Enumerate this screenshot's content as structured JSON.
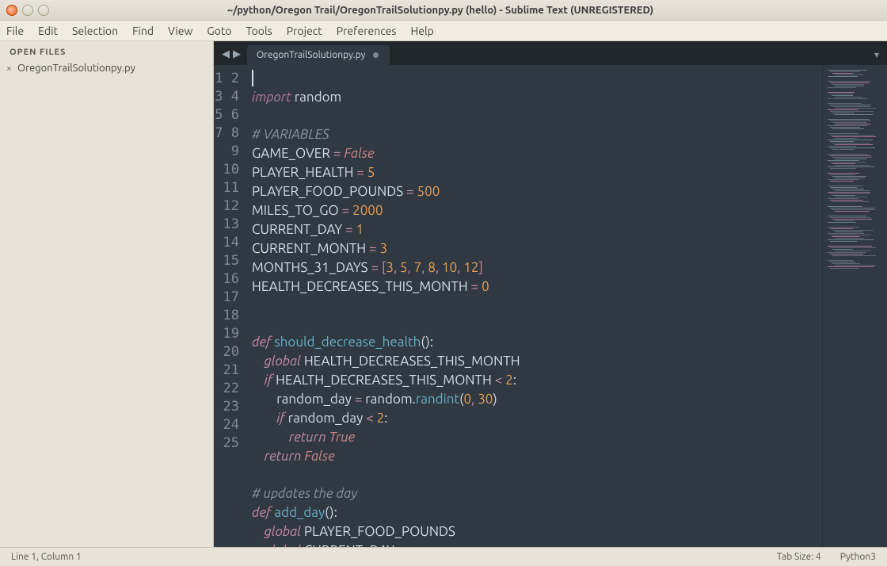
{
  "window": {
    "title": "~/python/Oregon Trail/OregonTrailSolutionpy.py (hello) - Sublime Text (UNREGISTERED)"
  },
  "menu": [
    "File",
    "Edit",
    "Selection",
    "Find",
    "View",
    "Goto",
    "Tools",
    "Project",
    "Preferences",
    "Help"
  ],
  "sidebar": {
    "heading": "OPEN FILES",
    "items": [
      {
        "close": "×",
        "label": "OregonTrailSolutionpy.py"
      }
    ]
  },
  "tabbar": {
    "nav_back": "◀",
    "nav_fwd": "▶",
    "tabs": [
      {
        "label": "OregonTrailSolutionpy.py"
      }
    ],
    "more": "▾"
  },
  "gutter_start": 1,
  "gutter_end": 25,
  "code": {
    "l1_import": "import",
    "l1_mod": " random",
    "l3_comment": "# VARIABLES",
    "l4_var": "GAME_OVER",
    "eq": " = ",
    "l4_val": "False",
    "l5_var": "PLAYER_HEALTH",
    "l5_val": "5",
    "l6_var": "PLAYER_FOOD_POUNDS",
    "l6_val": "500",
    "l7_var": "MILES_TO_GO",
    "l7_val": "2000",
    "l8_var": "CURRENT_DAY",
    "l8_val": "1",
    "l9_var": "CURRENT_MONTH",
    "l9_val": "3",
    "l10_var": "MONTHS_31_DAYS",
    "l10_open": " = [",
    "l10_close": "]",
    "l10_a": "3",
    "l10_b": "5",
    "l10_c": "7",
    "l10_d": "8",
    "l10_e": "10",
    "l10_f": "12",
    "comma": ", ",
    "l11_var": "HEALTH_DECREASES_THIS_MONTH",
    "l11_val": "0",
    "l14_def": "def",
    "l14_func": " should_decrease_health",
    "l14_par": "():",
    "indent1": "    ",
    "indent2": "        ",
    "indent3": "            ",
    "l15_global": "global",
    "l15_name": " HEALTH_DECREASES_THIS_MONTH",
    "l16_if": "if",
    "l16_name": " HEALTH_DECREASES_THIS_MONTH ",
    "l16_lt": "<",
    "l16_num": " 2",
    "colon": ":",
    "l17_var": "random_day ",
    "l17_eq": "= ",
    "l17_mod": "random",
    "dot": ".",
    "l17_call": "randint",
    "l17_args_open": "(",
    "l17_a": "0",
    "l17_b": "30",
    "l17_args_close": ")",
    "l18_if": "if",
    "l18_name": " random_day ",
    "l18_lt": "<",
    "l18_num": " 2",
    "l19_return": "return",
    "l19_val": " True",
    "l20_return": "return",
    "l20_val": " False",
    "l22_comment": "# updates the day",
    "l23_def": "def",
    "l23_func": " add_day",
    "l23_par": "():",
    "l24_global": "global",
    "l24_name": " PLAYER_FOOD_POUNDS",
    "l25_global": "global",
    "l25_name": " CURRENT_DAY"
  },
  "status": {
    "pos": "Line 1, Column 1",
    "tabsize": "Tab Size: 4",
    "lang": "Python3"
  }
}
